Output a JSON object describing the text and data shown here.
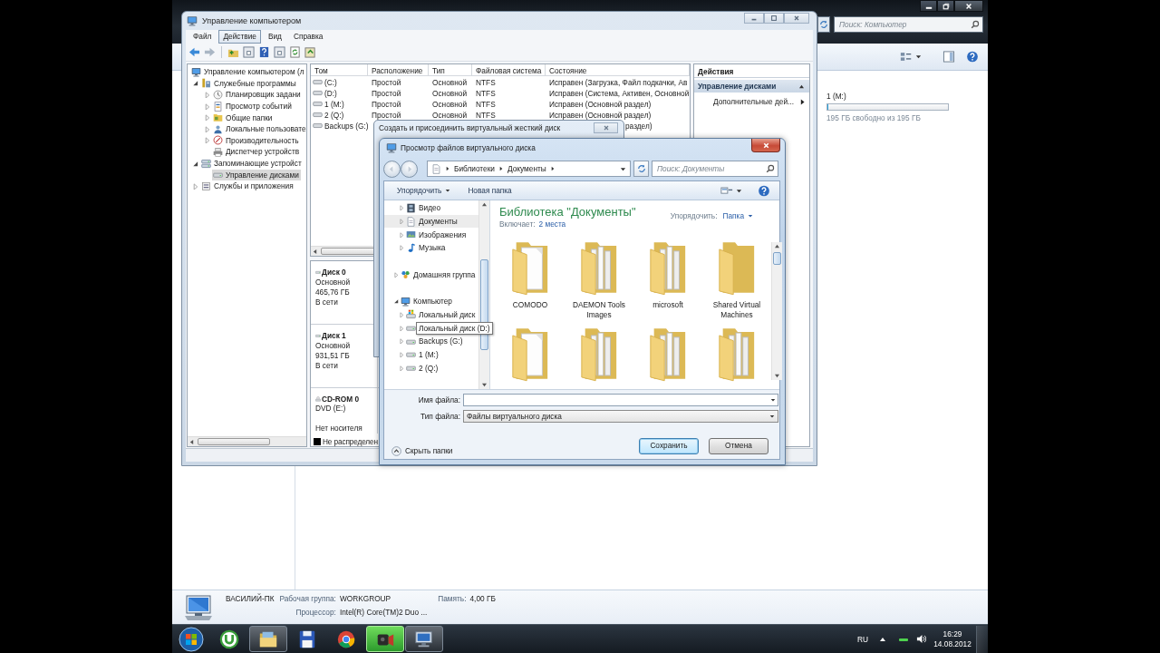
{
  "explorer": {
    "search": {
      "placeholder": "Поиск: Компьютер"
    },
    "drive": {
      "name": "1 (M:)",
      "level": 0,
      "free": "195 ГБ свободно из 195 ГБ"
    },
    "details": {
      "computer": "ВАСИЛИЙ-ПК",
      "workgroup_label": "Рабочая группа:",
      "workgroup": "WORKGROUP",
      "memory_label": "Память:",
      "memory": "4,00 ГБ",
      "cpu_label": "Процессор:",
      "cpu": "Intel(R) Core(TM)2 Duo ..."
    }
  },
  "mmc": {
    "title": "Управление компьютером",
    "menu": [
      {
        "label": "Файл",
        "selected": false
      },
      {
        "label": "Действие",
        "selected": true
      },
      {
        "label": "Вид",
        "selected": false
      },
      {
        "label": "Справка",
        "selected": false
      }
    ],
    "tree": [
      {
        "label": "Управление компьютером (л",
        "kind": "computer",
        "selected": false,
        "children": [
          {
            "label": "Служебные программы",
            "kind": "toolbox",
            "expanded": true,
            "selected": false,
            "children": [
              {
                "label": "Планировщик задани",
                "kind": "clock",
                "expanded": false,
                "selected": false
              },
              {
                "label": "Просмотр событий",
                "kind": "log",
                "expanded": false,
                "selected": false
              },
              {
                "label": "Общие папки",
                "kind": "folder",
                "expanded": false,
                "selected": false
              },
              {
                "label": "Локальные пользовате",
                "kind": "user",
                "expanded": false,
                "selected": false
              },
              {
                "label": "Производительность",
                "kind": "gauge",
                "expanded": false,
                "selected": false
              },
              {
                "label": "Диспетчер устройств",
                "kind": "printer",
                "selected": false
              }
            ]
          },
          {
            "label": "Запоминающие устройст",
            "kind": "storage",
            "expanded": true,
            "selected": false,
            "children": [
              {
                "label": "Управление дисками",
                "kind": "drive",
                "selected": true
              }
            ]
          },
          {
            "label": "Службы и приложения",
            "kind": "services",
            "expanded": false,
            "selected": false
          }
        ]
      }
    ],
    "volumes": {
      "columns": [
        "Том",
        "Расположение",
        "Тип",
        "Файловая система",
        "Состояние"
      ],
      "rows": [
        {
          "volume": "(C:)",
          "layout": "Простой",
          "type": "Основной",
          "fs": "NTFS",
          "status": "Исправен (Загрузка, Файл подкачки, Ав"
        },
        {
          "volume": "(D:)",
          "layout": "Простой",
          "type": "Основной",
          "fs": "NTFS",
          "status": "Исправен (Система, Активен, Основной"
        },
        {
          "volume": "1 (M:)",
          "layout": "Простой",
          "type": "Основной",
          "fs": "NTFS",
          "status": "Исправен (Основной раздел)"
        },
        {
          "volume": "2 (Q:)",
          "layout": "Простой",
          "type": "Основной",
          "fs": "NTFS",
          "status": "Исправен (Основной раздел)"
        },
        {
          "volume": "Backups (G:)",
          "status": "раздел)"
        }
      ]
    },
    "disks": [
      {
        "kind": "disk",
        "name": "Диск 0",
        "type": "Основной",
        "size": "465,76 ГБ",
        "status": "В сети"
      },
      {
        "kind": "disk",
        "name": "Диск 1",
        "type": "Основной",
        "size": "931,51 ГБ",
        "status": "В сети"
      },
      {
        "kind": "cdrom",
        "name": "CD-ROM 0",
        "type": "DVD (E:)",
        "status": "Нет носителя"
      }
    ],
    "legend": [
      {
        "label": "Не распределен",
        "color": "#000000"
      }
    ],
    "actions": {
      "title": "Действия",
      "section": "Управление дисками",
      "items": [
        "Дополнительные дей..."
      ]
    }
  },
  "create_dialog": {
    "title": "Создать и присоединить виртуальный жесткий диск"
  },
  "browse_dialog": {
    "title": "Просмотр файлов виртуального диска",
    "breadcrumb": [
      "Библиотеки",
      "Документы"
    ],
    "search": {
      "placeholder": "Поиск: Документы"
    },
    "toolbar": [
      {
        "label": "Упорядочить",
        "dropdown": true
      },
      {
        "label": "Новая папка",
        "dropdown": false
      }
    ],
    "nav": [
      {
        "children": [
          {
            "label": "Видео",
            "kind": "video",
            "expanded": false,
            "selected": false,
            "hovered": false
          },
          {
            "label": "Документы",
            "kind": "document",
            "expanded": false,
            "selected": true,
            "hovered": false
          },
          {
            "label": "Изображения",
            "kind": "pictures",
            "expanded": false,
            "selected": false,
            "hovered": false
          },
          {
            "label": "Музыка",
            "kind": "music",
            "expanded": false,
            "selected": false,
            "hovered": false
          }
        ]
      },
      {
        "label": "Домашняя группа",
        "kind": "group",
        "expanded": false,
        "selected": false,
        "hovered": false
      },
      {
        "label": "Компьютер",
        "kind": "computer",
        "expanded": true,
        "selected": false,
        "hovered": false,
        "children": [
          {
            "label": "Локальный диск",
            "kind": "sysdrive",
            "expanded": false,
            "selected": false,
            "hovered": false
          },
          {
            "label": "Локальный диск (D:)",
            "kind": "drive",
            "expanded": false,
            "selected": false,
            "hovered": true
          },
          {
            "label": "Backups (G:)",
            "kind": "drive",
            "expanded": false,
            "selected": false,
            "hovered": false
          },
          {
            "label": "1 (M:)",
            "kind": "drive",
            "expanded": false,
            "selected": false,
            "hovered": false
          },
          {
            "label": "2 (Q:)",
            "kind": "drive",
            "expanded": false,
            "selected": false,
            "hovered": false
          }
        ]
      }
    ],
    "library": {
      "title": "Библиотека \"Документы\"",
      "includes_label": "Включает:",
      "includes_link": "2 места",
      "arrange_label": "Упорядочить:",
      "arrange_value": "Папка"
    },
    "folders": [
      {
        "name": "COMODO",
        "kind": "docs"
      },
      {
        "name": "DAEMON Tools Images",
        "kind": "files"
      },
      {
        "name": "microsoft",
        "kind": "files"
      },
      {
        "name": "Shared Virtual Machines",
        "kind": "plain"
      },
      {
        "kind": "docs"
      },
      {
        "kind": "files"
      },
      {
        "kind": "files"
      },
      {
        "kind": "files"
      }
    ],
    "filename": {
      "label": "Имя файла:"
    },
    "filetype": {
      "label": "Тип файла:",
      "value": "Файлы виртуального диска"
    },
    "hide_folders": "Скрыть папки",
    "buttons": [
      {
        "label": "Сохранить",
        "default": true
      },
      {
        "label": "Отмена",
        "default": false
      }
    ]
  },
  "taskbar": {
    "apps": [
      {
        "kind": "torrent",
        "active": false,
        "hovered": false
      },
      {
        "kind": "folder",
        "active": true,
        "hovered": false
      },
      {
        "kind": "floppy",
        "active": false,
        "hovered": false
      },
      {
        "kind": "browser",
        "active": false,
        "hovered": false
      },
      {
        "kind": "camcorder",
        "active": true,
        "hovered": true
      },
      {
        "kind": "computer",
        "active": true,
        "hovered": false
      }
    ],
    "language": "RU",
    "time": "16:29",
    "date": "14.08.2012"
  }
}
